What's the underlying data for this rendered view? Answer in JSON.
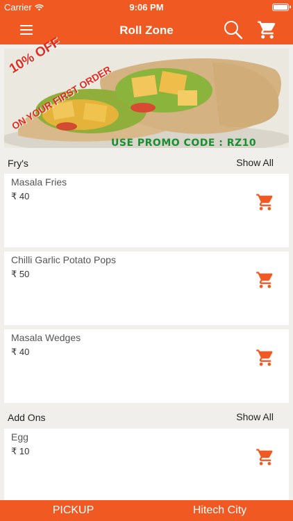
{
  "status_bar": {
    "carrier": "Carrier",
    "time": "9:06 PM"
  },
  "header": {
    "title": "Roll Zone",
    "icons": [
      "menu-icon",
      "search-icon",
      "cart-icon"
    ]
  },
  "banner": {
    "offer": "10% OFF",
    "first_order": "ON YOUR FIRST ORDER",
    "promo": "USE PROMO CODE : RZ10"
  },
  "sections": [
    {
      "name": "Fry's",
      "show_all": "Show All",
      "items": [
        {
          "name": "Masala Fries",
          "price": "₹ 40"
        },
        {
          "name": "Chilli Garlic Potato Pops",
          "price": "₹ 50"
        },
        {
          "name": "Masala Wedges",
          "price": "₹ 40"
        }
      ]
    },
    {
      "name": "Add Ons",
      "show_all": "Show All",
      "items": [
        {
          "name": "Egg",
          "price": "₹ 10"
        }
      ]
    }
  ],
  "bottom_bar": {
    "pickup": "PICKUP",
    "location": "Hitech City"
  },
  "colors": {
    "brand": "#f05a22",
    "promo_red": "#e42a1f",
    "promo_green": "#1e8c32",
    "background": "#f0efeb"
  }
}
